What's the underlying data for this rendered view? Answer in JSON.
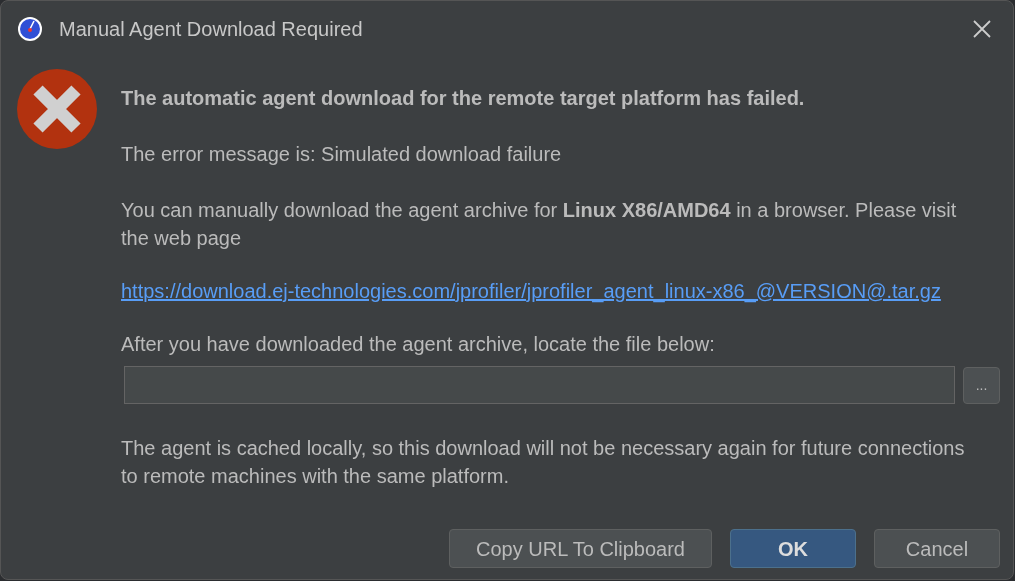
{
  "window": {
    "title": "Manual Agent Download Required"
  },
  "heading": "The automatic agent download for the remote target platform has failed.",
  "error_message": "The error message is: Simulated download failure",
  "instructions": "You can manually download the agent archive for **Linux X86/AMD64** in a browser. Please visit the web page",
  "link": "https://download.ej-technologies.com/jprofiler/jprofiler_agent_linux-x86_@VERSION@.tar.gz",
  "file_prompt": "After you have downloaded the agent archive, locate the file below:",
  "browse_button": "...",
  "note": "The agent is cached locally, so this download will not be necessary again for future connections to remote machines with the same platform.",
  "buttons": [
    {
      "label": "Copy URL To Clipboard",
      "kind": "normal"
    },
    {
      "label": "OK",
      "kind": "primary"
    },
    {
      "label": "Cancel",
      "kind": "normal"
    }
  ]
}
